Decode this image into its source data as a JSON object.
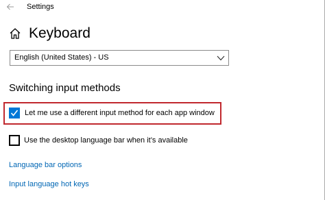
{
  "window": {
    "title": "Settings"
  },
  "header": {
    "title": "Keyboard"
  },
  "language_select": {
    "selected": "English (United States) - US"
  },
  "section": {
    "heading": "Switching input methods",
    "options": [
      {
        "label": "Let me use a different input method for each app window",
        "checked": true
      },
      {
        "label": "Use the desktop language bar when it’s available",
        "checked": false
      }
    ]
  },
  "links": [
    {
      "label": "Language bar options"
    },
    {
      "label": "Input language hot keys"
    }
  ],
  "colors": {
    "accent": "#0078d7",
    "link": "#0066b4",
    "highlight": "#c0272d"
  },
  "icons": {
    "back": "back-arrow-icon",
    "home": "home-icon",
    "chevron": "chevron-down-icon",
    "check": "checkmark-icon"
  }
}
